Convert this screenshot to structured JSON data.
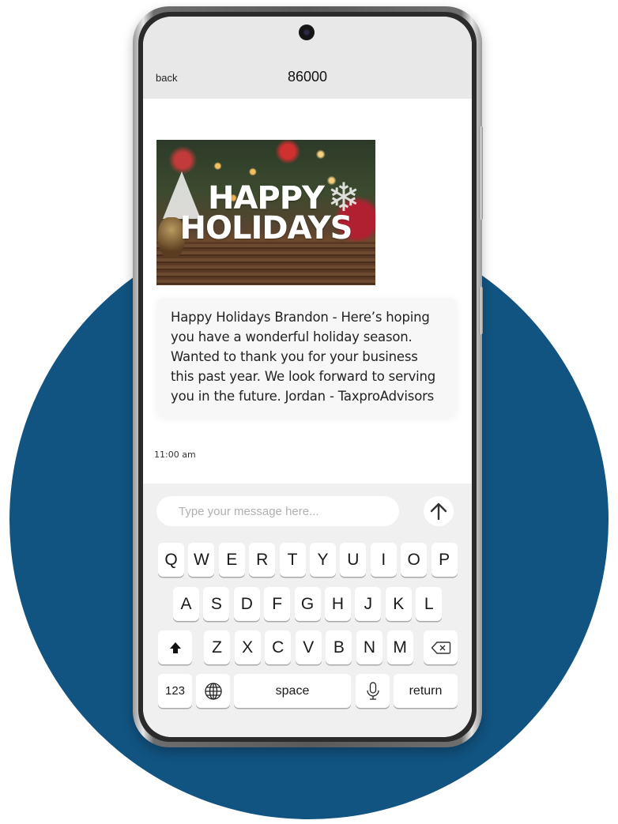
{
  "background": {
    "circle_color": "#115381"
  },
  "header": {
    "back_label": "back",
    "contact": "86000"
  },
  "conversation": {
    "image": {
      "description": "Happy Holidays greeting image with festive bokeh background",
      "caption_line1": "HAPPY",
      "caption_line2": "HOLIDAYS"
    },
    "message": "Happy Holidays Brandon - Here’s hoping you have a wonderful holiday season. Wanted to thank you for your business this past year. We look forward to serving you in the future. Jordan - TaxproAdvisors",
    "timestamp": "11:00 am"
  },
  "composer": {
    "placeholder": "Type your message here...",
    "value": "",
    "send_icon": "arrow-up-icon"
  },
  "keyboard": {
    "row1": [
      "Q",
      "W",
      "E",
      "R",
      "T",
      "Y",
      "U",
      "I",
      "O",
      "P"
    ],
    "row2": [
      "A",
      "S",
      "D",
      "F",
      "G",
      "H",
      "J",
      "K",
      "L"
    ],
    "row3": [
      "Z",
      "X",
      "C",
      "V",
      "B",
      "N",
      "M"
    ],
    "shift_icon": "shift-icon",
    "backspace_icon": "backspace-icon",
    "numbers_label": "123",
    "globe_icon": "globe-icon",
    "space_label": "space",
    "mic_icon": "microphone-icon",
    "return_label": "return"
  }
}
